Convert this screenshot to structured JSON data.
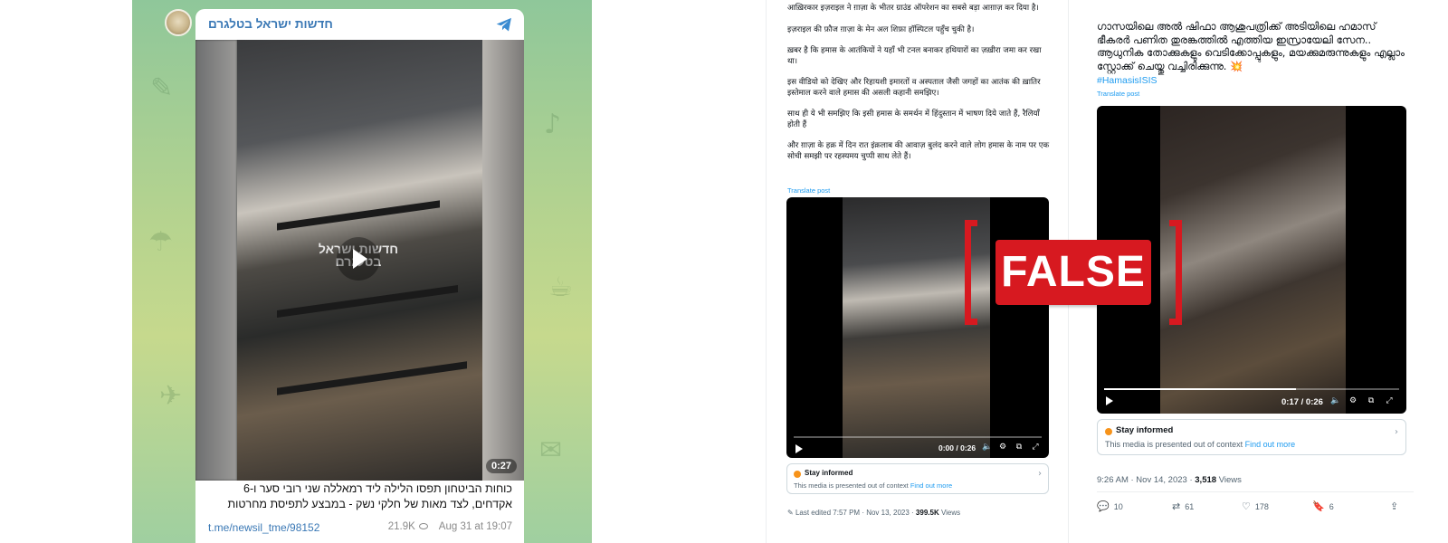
{
  "telegram": {
    "channel_name": "חדשות ישראל בטלגרם",
    "video_watermark": "חדשות ישראל בטלגרם",
    "video_duration": "0:27",
    "caption": "כוחות הביטחון תפסו הלילה ליד רמאללה שני רובי סער ו-6 אקדחים, לצד מאות של חלקי נשק - במבצע לתפיסת מחרטות",
    "link": "t.me/newsil_tme/98152",
    "views": "21.9K",
    "date": "Aug 31 at 19:07"
  },
  "tweet_hindi": {
    "paragraphs": [
      "आख़िरकार इज़राइल ने ग़ाज़ा के भीतर ग्राउंड ऑपरेशन का सबसे बड़ा आग़ाज़ कर दिया है।",
      "इज़राइल की फ़ौज ग़ाज़ा के मेन अल शिफ़ा हॉस्पिटल पहुँच चुकी है।",
      "ख़बर है कि हमास के आतंकियों ने यहाँ भी टनल बनाकर हथियारों का ज़ख़ीरा जमा कर रखा था।",
      "इस वीडियो को देखिए और रिहायशी इमारतों व अस्पताल जैसी जगहों का आतंक की ख़ातिर इस्तेमाल करने वाले हमास की असली कहानी समझिए।",
      "साथ ही ये भी समझिए कि इसी हमास के समर्थन में हिंदुस्तान में भाषण दिये जाते हैं, रैलियाँ होती हैं",
      "और ग़ाज़ा के हक़ में दिन रात इंक़लाब की आवाज़ बुलंद करने वाले लोग हमास के नाम पर एक सोची समझी पर रहस्यमय चुप्पी साध लेते हैं।"
    ],
    "translate": "Translate post",
    "video_time": "0:00 / 0:26",
    "notice_title": "Stay informed",
    "notice_body": "This media is presented out of context",
    "notice_link": "Find out more",
    "edited_label": "Last edited 7:57 PM · Nov 13, 2023 ·",
    "views_count": "399.5K",
    "views_label": "Views"
  },
  "tweet_malayalam": {
    "text": "ഗാസയിലെ അൽ ഷിഫാ ആശുപത്രിക്ക് അടിയിലെ ഹമാസ് ഭീകരർ പണിത തുരങ്കത്തിൽ എത്തിയ ഇസ്രായേലി സേന.. ആധുനിക തോക്കുകളും വെടിക്കോപ്പുകളും, മയക്കുമരുന്നുകളും എല്ലാം സ്റ്റോക്ക് ചെയ്തു വച്ചിരിക്കുന്നു. 💥",
    "hashtag": "#HamasisISIS",
    "translate": "Translate post",
    "video_time": "0:17 / 0:26",
    "video_progress": 0.65,
    "notice_title": "Stay informed",
    "notice_body": "This media is presented out of context",
    "notice_link": "Find out more",
    "timestamp": "9:26 AM · Nov 14, 2023 ·",
    "views_count": "3,518",
    "views_label": "Views",
    "replies": "10",
    "reposts": "61",
    "likes": "178",
    "bookmarks": "6"
  },
  "stamp": {
    "label": "FALSE"
  },
  "colors": {
    "stamp_red": "#d71920",
    "link_blue": "#1d9bf0",
    "telegram_blue": "#3a78b5",
    "notice_orange": "#f7931a"
  }
}
